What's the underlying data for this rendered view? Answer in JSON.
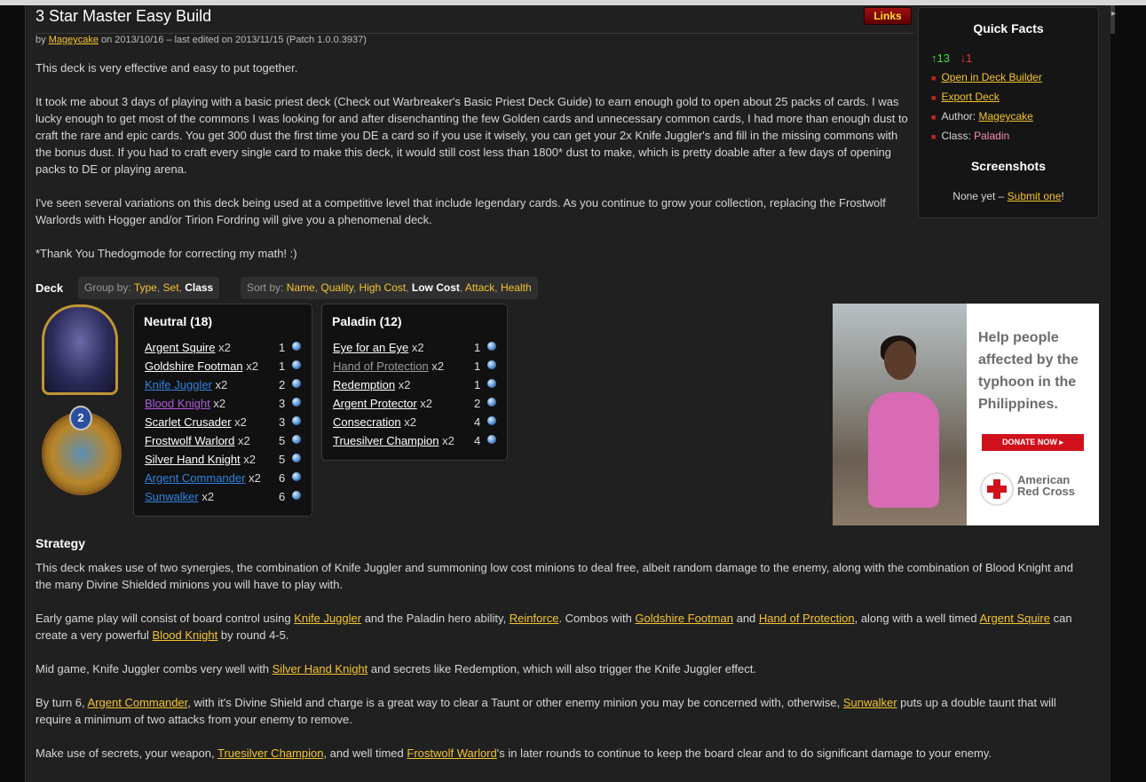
{
  "title": "3 Star Master Easy Build",
  "links_button": "Links",
  "byline": {
    "by": "by",
    "author": "Mageycake",
    "rest": "on 2013/10/16 – last edited on 2013/11/15 (Patch 1.0.0.3937)"
  },
  "description": [
    "This deck is very effective and easy to put together.",
    "It took me about 3 days of playing with a basic priest deck (Check out Warbreaker's Basic Priest Deck Guide) to earn enough gold to open about 25 packs of cards. I was lucky enough to get most of the commons I was looking for and after disenchanting the few Golden cards and unnecessary common cards, I had more than enough dust to craft the rare and epic cards. You get 300 dust the first time you DE a card so if you use it wisely, you can get your 2x Knife Juggler's and fill in the missing commons with the bonus dust. If you had to craft every single card to make this deck, it would still cost less than 1800* dust to make, which is pretty doable after a few days of opening packs to DE or playing arena.",
    "I've seen several variations on this deck being used at a competitive level that include legendary cards. As you continue to grow your collection, replacing the Frostwolf Warlords with Hogger and/or Tirion Fordring will give you a phenomenal deck.",
    "*Thank You Thedogmode for correcting my math! :)"
  ],
  "quick_facts": {
    "title": "Quick Facts",
    "votes_up": "13",
    "votes_down": "1",
    "open_deck_builder": "Open in Deck Builder",
    "export_deck": "Export Deck",
    "author_label": "Author:",
    "author": "Mageycake",
    "class_label": "Class:",
    "class": "Paladin",
    "screenshots_title": "Screenshots",
    "none_yet": "None yet –",
    "submit_one": "Submit one",
    "bang": "!"
  },
  "deck": {
    "label": "Deck",
    "group_by_label": "Group by:",
    "group_by": {
      "type": "Type",
      "set": "Set",
      "class": "Class"
    },
    "sort_by_label": "Sort by:",
    "sort_by": {
      "name": "Name",
      "quality": "Quality",
      "high_cost": "High Cost",
      "low_cost": "Low Cost",
      "attack": "Attack",
      "health": "Health"
    },
    "hero_power_cost": "2",
    "neutral": {
      "title": "Neutral (18)",
      "cards": [
        {
          "name": "Argent Squire",
          "count": "x2",
          "cost": "1",
          "quality": "common"
        },
        {
          "name": "Goldshire Footman",
          "count": "x2",
          "cost": "1",
          "quality": "common"
        },
        {
          "name": "Knife Juggler",
          "count": "x2",
          "cost": "2",
          "quality": "rare"
        },
        {
          "name": "Blood Knight",
          "count": "x2",
          "cost": "3",
          "quality": "epic"
        },
        {
          "name": "Scarlet Crusader",
          "count": "x2",
          "cost": "3",
          "quality": "common"
        },
        {
          "name": "Frostwolf Warlord",
          "count": "x2",
          "cost": "5",
          "quality": "common"
        },
        {
          "name": "Silver Hand Knight",
          "count": "x2",
          "cost": "5",
          "quality": "common"
        },
        {
          "name": "Argent Commander",
          "count": "x2",
          "cost": "6",
          "quality": "rare"
        },
        {
          "name": "Sunwalker",
          "count": "x2",
          "cost": "6",
          "quality": "rare"
        }
      ]
    },
    "paladin": {
      "title": "Paladin (12)",
      "cards": [
        {
          "name": "Eye for an Eye",
          "count": "x2",
          "cost": "1",
          "quality": "common"
        },
        {
          "name": "Hand of Protection",
          "count": "x2",
          "cost": "1",
          "quality": "free"
        },
        {
          "name": "Redemption",
          "count": "x2",
          "cost": "1",
          "quality": "common"
        },
        {
          "name": "Argent Protector",
          "count": "x2",
          "cost": "2",
          "quality": "common"
        },
        {
          "name": "Consecration",
          "count": "x2",
          "cost": "4",
          "quality": "common"
        },
        {
          "name": "Truesilver Champion",
          "count": "x2",
          "cost": "4",
          "quality": "common"
        }
      ]
    }
  },
  "ad": {
    "headline": "Help people affected by the typhoon in the Philippines.",
    "button": "DONATE NOW ▸",
    "org_line1": "American",
    "org_line2": "Red Cross"
  },
  "strategy": {
    "title": "Strategy",
    "p1": "This deck makes use of two synergies, the combination of Knife Juggler and summoning low cost minions to deal free, albeit random damage to the enemy, along with the combination of Blood Knight and the many Divine Shielded minions you will have to play with.",
    "p2": {
      "t1": "Early game play will consist of board control using ",
      "l1": "Knife Juggler",
      "t2": " and the Paladin hero ability, ",
      "l2": "Reinforce",
      "t3": ". Combos with ",
      "l3": "Goldshire Footman",
      "t4": " and ",
      "l4": "Hand of Protection",
      "t5": ", along with a well timed ",
      "l5": "Argent Squire",
      "t6": " can create a very powerful ",
      "l6": "Blood Knight",
      "t7": " by round 4-5."
    },
    "p3": {
      "t1": "Mid game, Knife Juggler combs very well with ",
      "l1": "Silver Hand Knight",
      "t2": " and secrets like Redemption, which will also trigger the Knife Juggler effect."
    },
    "p4": {
      "t1": "By turn 6, ",
      "l1": "Argent Commander",
      "t2": ", with it's Divine Shield and charge is a great way to clear a Taunt or other enemy minion you may be concerned with, otherwise, ",
      "l2": "Sunwalker",
      "t3": " puts up a double taunt that will require a minimum of two attacks from your enemy to remove."
    },
    "p5": {
      "t1": "Make use of secrets, your weapon, ",
      "l1": "Truesilver Champion",
      "t2": ", and well timed ",
      "l2": "Frostwolf Warlord",
      "t3": "'s in later rounds to continue to keep the board clear and to do significant damage to your enemy."
    }
  }
}
